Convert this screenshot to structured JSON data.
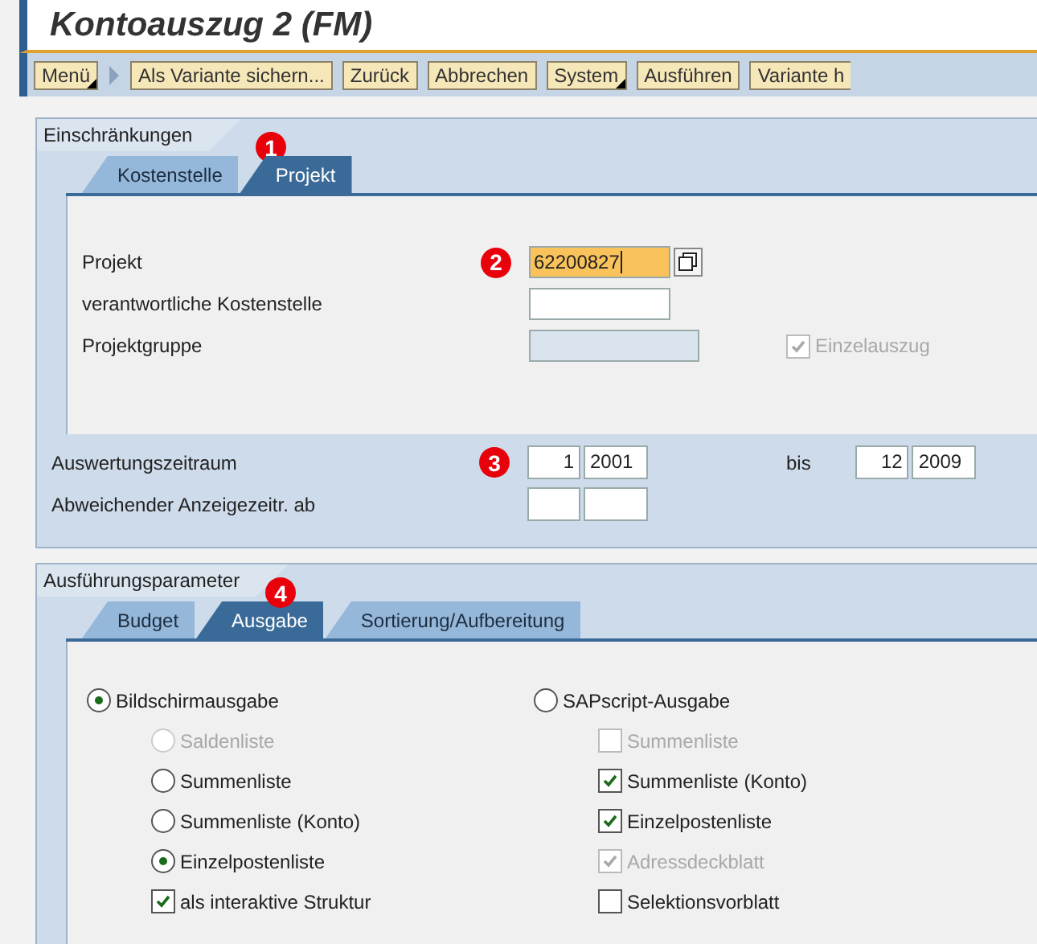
{
  "title": "Kontoauszug 2 (FM)",
  "toolbar": [
    {
      "kind": "menu",
      "label": "Menü"
    },
    {
      "kind": "arrow"
    },
    {
      "kind": "button",
      "label": "Als Variante sichern..."
    },
    {
      "kind": "button",
      "label": "Zurück"
    },
    {
      "kind": "button",
      "label": "Abbrechen"
    },
    {
      "kind": "menu",
      "label": "System"
    },
    {
      "kind": "button",
      "label": "Ausführen"
    },
    {
      "kind": "button",
      "label": "Variante h"
    }
  ],
  "restrictions": {
    "title": "Einschränkungen",
    "badge": "1",
    "tabs": [
      {
        "label": "Kostenstelle",
        "selected": false
      },
      {
        "label": "Projekt",
        "selected": true
      }
    ],
    "fields": [
      {
        "label": "Projekt",
        "value": "62200827",
        "highlighted": true,
        "badge": "2",
        "disabled": false
      },
      {
        "label": "verantwortliche Kostenstelle",
        "highlighted": false,
        "disabled": false
      },
      {
        "label": "Projektgruppe",
        "highlighted": false,
        "disabled": true
      }
    ],
    "option": {
      "label": "Einzelauszug",
      "checked": true,
      "disabled": true
    },
    "period": {
      "label": "Auswertungszeitraum",
      "badge": "3",
      "from_month": "1",
      "from_year": "2001",
      "to_label": "bis",
      "to_month": "12",
      "to_year": "2009"
    },
    "alt_period": {
      "label": "Abweichender Anzeigezeitr. ab"
    }
  },
  "parameters": {
    "title": "Ausführungsparameter",
    "badge": "4",
    "tabs": [
      {
        "label": "Budget",
        "selected": false
      },
      {
        "label": "Ausgabe",
        "selected": true
      },
      {
        "label": "Sortierung/Aufbereitung",
        "selected": false
      }
    ],
    "columns": [
      {
        "kind": "radio",
        "label": "Bildschirmausgabe",
        "selected": true,
        "disabled": false,
        "children": [
          {
            "kind": "radio",
            "label": "Saldenliste",
            "selected": false,
            "disabled": true
          },
          {
            "kind": "radio",
            "label": "Summenliste",
            "selected": false,
            "disabled": false
          },
          {
            "kind": "radio",
            "label": "Summenliste (Konto)",
            "selected": false,
            "disabled": false
          },
          {
            "kind": "radio",
            "label": "Einzelpostenliste",
            "selected": true,
            "disabled": false
          },
          {
            "kind": "checkbox",
            "label": "als interaktive Struktur",
            "checked": true,
            "disabled": false
          }
        ]
      },
      {
        "kind": "radio",
        "label": "SAPscript-Ausgabe",
        "selected": false,
        "disabled": false,
        "children": [
          {
            "kind": "checkbox",
            "label": "Summenliste",
            "checked": false,
            "disabled": true
          },
          {
            "kind": "checkbox",
            "label": "Summenliste (Konto)",
            "checked": true,
            "disabled": false
          },
          {
            "kind": "checkbox",
            "label": "Einzelpostenliste",
            "checked": true,
            "disabled": false
          },
          {
            "kind": "checkbox",
            "label": "Adressdeckblatt",
            "checked": true,
            "disabled": true
          },
          {
            "kind": "checkbox",
            "label": "Selektionsvorblatt",
            "checked": false,
            "disabled": false
          }
        ]
      }
    ]
  }
}
